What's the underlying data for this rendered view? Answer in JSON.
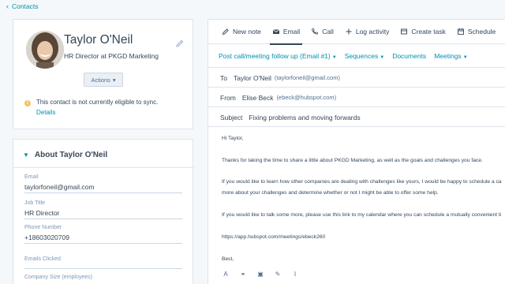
{
  "nav": {
    "back_label": "Contacts"
  },
  "profile": {
    "name": "Taylor O'Neil",
    "role": "HR Director at PKGD Marketing",
    "actions_label": "Actions",
    "sync_warning": "This contact is not currently eligible to sync.",
    "details_link": "Details"
  },
  "about": {
    "title": "About Taylor O'Neil",
    "fields": [
      {
        "label": "Email",
        "value": "taylorfoneil@gmail.com"
      },
      {
        "label": "Job Title",
        "value": "HR Director"
      },
      {
        "label": "Phone Number",
        "value": "+18603020709"
      },
      {
        "label": "Emails Clicked",
        "value": ""
      },
      {
        "label": "Company Size (employees)",
        "value": ""
      }
    ]
  },
  "tabs": [
    {
      "label": "New note",
      "icon": "note-icon"
    },
    {
      "label": "Email",
      "icon": "envelope-icon"
    },
    {
      "label": "Call",
      "icon": "phone-icon"
    },
    {
      "label": "Log activity",
      "icon": "plus-icon"
    },
    {
      "label": "Create task",
      "icon": "task-icon"
    },
    {
      "label": "Schedule",
      "icon": "calendar-icon"
    }
  ],
  "email_tools": {
    "template": "Post call/meeting follow up (Email #1)",
    "sequences": "Sequences",
    "documents": "Documents",
    "meetings": "Meetings"
  },
  "email": {
    "to_label": "To",
    "to_name": "Taylor O'Neil",
    "to_address": "(taylorfoneil@gmail.com)",
    "from_label": "From",
    "from_name": "Elise Beck",
    "from_address": "(ebeck@hubspot.com)",
    "subject_label": "Subject",
    "subject": "Fixing problems and moving forwards",
    "body": [
      "Hi Taylor,",
      "Thanks for taking the time to share a little about PKGD Marketing, as well as the goals and challenges you face.",
      "If you would like to learn how other companies are dealing with challenges like yours, I would be happy to schedule a ca",
      "more about your challenges and determine whether or not I might be able to offer some help.",
      "If you would like to talk some more, please use this link to my calendar where you can schedule a mutually convenient ti",
      "https://app.hubspot.com/meetings/ebeck260",
      "Best,"
    ]
  },
  "colors": {
    "link": "#0091ae",
    "text": "#33475b",
    "border": "#dfe3eb",
    "background": "#f5f8fa"
  }
}
